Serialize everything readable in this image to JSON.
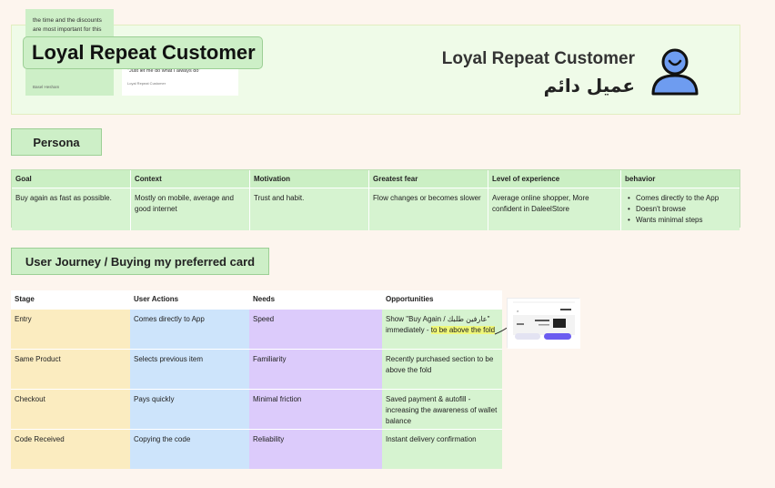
{
  "header": {
    "sticky_text": "the time and the discounts are most important for this",
    "sticky_author": "Basel Hesham",
    "quote_text": "\"Just let me do what I always do\"",
    "quote_author": "Loyal Repeat Customer",
    "main_title": "Loyal Repeat Customer",
    "title_en": "Loyal Repeat Customer",
    "title_ar": "عميل دائم",
    "icon": "user-icon",
    "icon_color": "#6e9cf0"
  },
  "persona": {
    "label": "Persona",
    "columns": [
      {
        "header": "Goal",
        "value": "Buy again as fast as possible."
      },
      {
        "header": "Context",
        "value": "Mostly on mobile, average and good internet"
      },
      {
        "header": "Motivation",
        "value": "Trust and habit."
      },
      {
        "header": "Greatest fear",
        "value": "Flow changes or becomes slower"
      },
      {
        "header": "Level of experience",
        "value": "Average online shopper, More confident in DaleelStore"
      }
    ],
    "behavior": {
      "header": "behavior",
      "items": [
        "Comes directly to the App",
        "Doesn't browse",
        "Wants minimal steps"
      ]
    }
  },
  "journey": {
    "label": "User Journey / Buying  my preferred card",
    "headers": [
      "Stage",
      "User Actions",
      "Needs",
      "Opportunities"
    ],
    "rows": [
      {
        "stage": "Entry",
        "action": "Comes directly to App",
        "need": "Speed",
        "opp_plain": "Show \"Buy Again / عارفين طلبك\" immediately - ",
        "opp_highlight": "to be above the fold"
      },
      {
        "stage": "Same Product",
        "action": "Selects previous item",
        "need": "Familiarity",
        "opp_plain": "Recently purchased section to be above the fold",
        "opp_highlight": ""
      },
      {
        "stage": "Checkout",
        "action": "Pays quickly",
        "need": "Minimal friction",
        "opp_plain": "Saved payment & autofill - increasing the awareness of wallet balance",
        "opp_highlight": ""
      },
      {
        "stage": "Code Received",
        "action": "Copying the code",
        "need": "Reliability",
        "opp_plain": "Instant delivery confirmation",
        "opp_highlight": ""
      }
    ]
  },
  "colors": {
    "background": "#fdf5ee",
    "green": "#cdefc7",
    "stage_yellow": "#fbecc0",
    "action_blue": "#cde4fb",
    "need_purple": "#dccbfb",
    "highlight": "#eef77a",
    "thumb_button": "#6b5cf0"
  }
}
